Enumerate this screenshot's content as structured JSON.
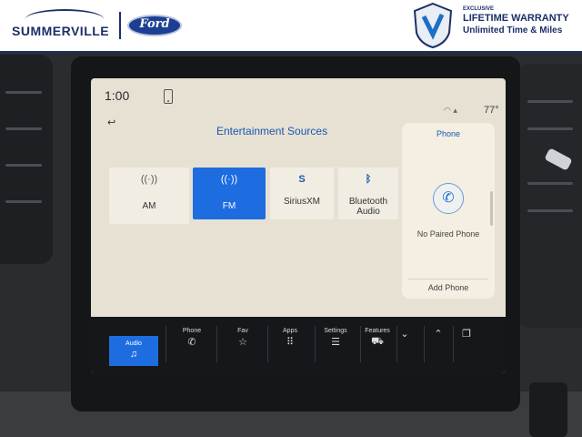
{
  "banner": {
    "dealer_name": "SUMMERVILLE",
    "brand": "Ford",
    "warranty_small": "EXCLUSIVE",
    "warranty_title": "LIFETIME WARRANTY",
    "warranty_sub": "Unlimited Time & Miles"
  },
  "status": {
    "time": "1:00",
    "temperature": "77°",
    "icons": [
      "phone-status-icon",
      "wifi-icon",
      "signal-icon"
    ]
  },
  "sources": {
    "title": "Entertainment Sources",
    "items": [
      {
        "label": "AM",
        "icon": "antenna-icon",
        "active": false
      },
      {
        "label": "FM",
        "icon": "antenna-icon",
        "active": true
      },
      {
        "label": "SiriusXM",
        "icon": "siriusxm-icon",
        "active": false
      },
      {
        "label": "Bluetooth Audio",
        "icon": "bluetooth-icon",
        "active": false
      }
    ]
  },
  "phone_panel": {
    "title": "Phone",
    "status": "No Paired Phone",
    "action": "Add Phone"
  },
  "nav": {
    "items": [
      {
        "label": "Audio",
        "icon": "music-note-icon",
        "active": true
      },
      {
        "label": "Phone",
        "icon": "phone-icon",
        "active": false
      },
      {
        "label": "Fav",
        "icon": "star-icon",
        "active": false
      },
      {
        "label": "Apps",
        "icon": "grid-icon",
        "active": false
      },
      {
        "label": "Settings",
        "icon": "sliders-icon",
        "active": false
      },
      {
        "label": "Features",
        "icon": "car-icon",
        "active": false
      },
      {
        "label": "",
        "icon": "chevron-down-icon",
        "active": false
      },
      {
        "label": "",
        "icon": "chevron-up-icon",
        "active": false
      },
      {
        "label": "",
        "icon": "windows-icon",
        "active": false
      }
    ]
  },
  "colors": {
    "accent": "#1d6de0",
    "screen_bg": "#e7e1d3",
    "nav_bg": "#15171a",
    "brand": "#1c2f66"
  }
}
